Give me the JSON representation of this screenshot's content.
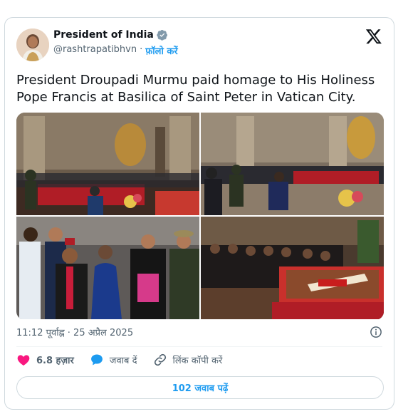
{
  "author": {
    "display_name": "President of India",
    "handle": "@rashtrapatibhvn",
    "separator": "·",
    "follow_label": "फ़ॉलो करें"
  },
  "tweet": {
    "text": "President Droupadi Murmu paid homage to His Holiness Pope Francis at Basilica of Saint Peter in Vatican City.",
    "timestamp": "11:12 पूर्वाह्न · 25 अप्रैल 2025"
  },
  "actions": {
    "likes_count": "6.8 हज़ार",
    "reply_label": "जवाब दें",
    "copy_link_label": "लिंक कॉपी करें"
  },
  "read_replies_label": "102 जवाब पढ़ें",
  "colors": {
    "accent": "#1d9bf0",
    "like": "#f91880",
    "text_primary": "#0f1419",
    "text_secondary": "#536471",
    "border": "#cfd9de"
  },
  "icons": [
    "verified-badge-icon",
    "x-logo-icon",
    "info-icon",
    "heart-icon",
    "reply-bubble-icon",
    "link-icon"
  ]
}
